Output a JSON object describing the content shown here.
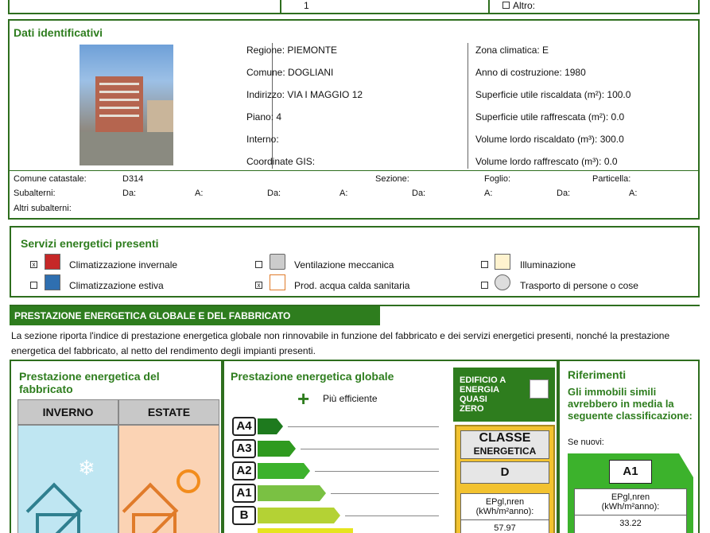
{
  "top_row": {
    "value": "1",
    "altro_label": "Altro:"
  },
  "dati": {
    "title": "Dati identificativi",
    "col1": [
      {
        "label": "Regione:",
        "value": "PIEMONTE"
      },
      {
        "label": "Comune:",
        "value": "DOGLIANI"
      },
      {
        "label": "Indirizzo:",
        "value": "VIA I MAGGIO 12"
      },
      {
        "label": "Piano:",
        "value": "4"
      },
      {
        "label": "Interno:",
        "value": ""
      },
      {
        "label": "Coordinate GIS:",
        "value": ""
      }
    ],
    "col2": [
      {
        "label": "Zona climatica:",
        "value": "E"
      },
      {
        "label": "Anno di costruzione:",
        "value": "1980"
      },
      {
        "label": "Superficie utile riscaldata (m²):",
        "value": "100.0"
      },
      {
        "label": "Superficie utile raffrescata (m²):",
        "value": "0.0"
      },
      {
        "label": "Volume lordo riscaldato (m³):",
        "value": "300.0"
      },
      {
        "label": "Volume lordo raffrescato (m³):",
        "value": "0.0"
      }
    ],
    "catasto": {
      "comune_label": "Comune catastale:",
      "comune_value": "D314",
      "sezione": "Sezione:",
      "foglio": "Foglio:",
      "particella": "Particella:",
      "subalterni": "Subalterni:",
      "da": "Da:",
      "a": "A:",
      "altri": "Altri subalterni:"
    }
  },
  "servizi": {
    "title": "Servizi energetici presenti",
    "items": [
      {
        "label": "Climatizzazione invernale",
        "checked": "x",
        "icon": "radiator-icon"
      },
      {
        "label": "Climatizzazione estiva",
        "checked": "",
        "icon": "air-conditioner-icon"
      },
      {
        "label": "Ventilazione meccanica",
        "checked": "",
        "icon": "fan-icon"
      },
      {
        "label": "Prod. acqua calda sanitaria",
        "checked": "x",
        "icon": "faucet-icon"
      },
      {
        "label": "Illuminazione",
        "checked": "",
        "icon": "lamp-icon"
      },
      {
        "label": "Trasporto di persone o cose",
        "checked": "",
        "icon": "gear-icon"
      }
    ]
  },
  "prestazione": {
    "header": "PRESTAZIONE ENERGETICA GLOBALE E DEL FABBRICATO",
    "description": "La sezione riporta l'indice di prestazione energetica globale non rinnovabile in funzione del fabbricato e dei servizi energetici presenti, nonché la prestazione energetica del fabbricato, al netto del rendimento degli impianti presenti.",
    "fabbricato_title": "Prestazione energetica del fabbricato",
    "inverno": "INVERNO",
    "estate": "ESTATE",
    "globale_title": "Prestazione energetica globale",
    "piu_efficiente": "Più efficiente",
    "classes": [
      "A4",
      "A3",
      "A2",
      "A1",
      "B"
    ],
    "nzeb": "EDIFICIO A ENERGIA QUASI ZERO",
    "classe_label": "CLASSE",
    "energetica_label": "ENERGETICA",
    "classe_value": "D",
    "ep_label": "EPgl,nren (kWh/m²anno):",
    "ep_value": "57.97",
    "rif_title": "Riferimenti",
    "rif_text": "Gli immobili simili avrebbero in media la seguente classificazione:",
    "se_nuovi": "Se nuovi:",
    "rif_class": "A1",
    "rif_ep_label": "EPgl,nren (kWh/m²anno):",
    "rif_ep_value": "33.22"
  },
  "colors": {
    "green": "#2e7d1e",
    "a4": "#1e7a1e",
    "a3": "#2f9a1f",
    "a2": "#3cb22c",
    "a1": "#7ac143",
    "b": "#b4d234",
    "inverno_bg": "#bfe6f2",
    "estate_bg": "#fbd3b4"
  }
}
